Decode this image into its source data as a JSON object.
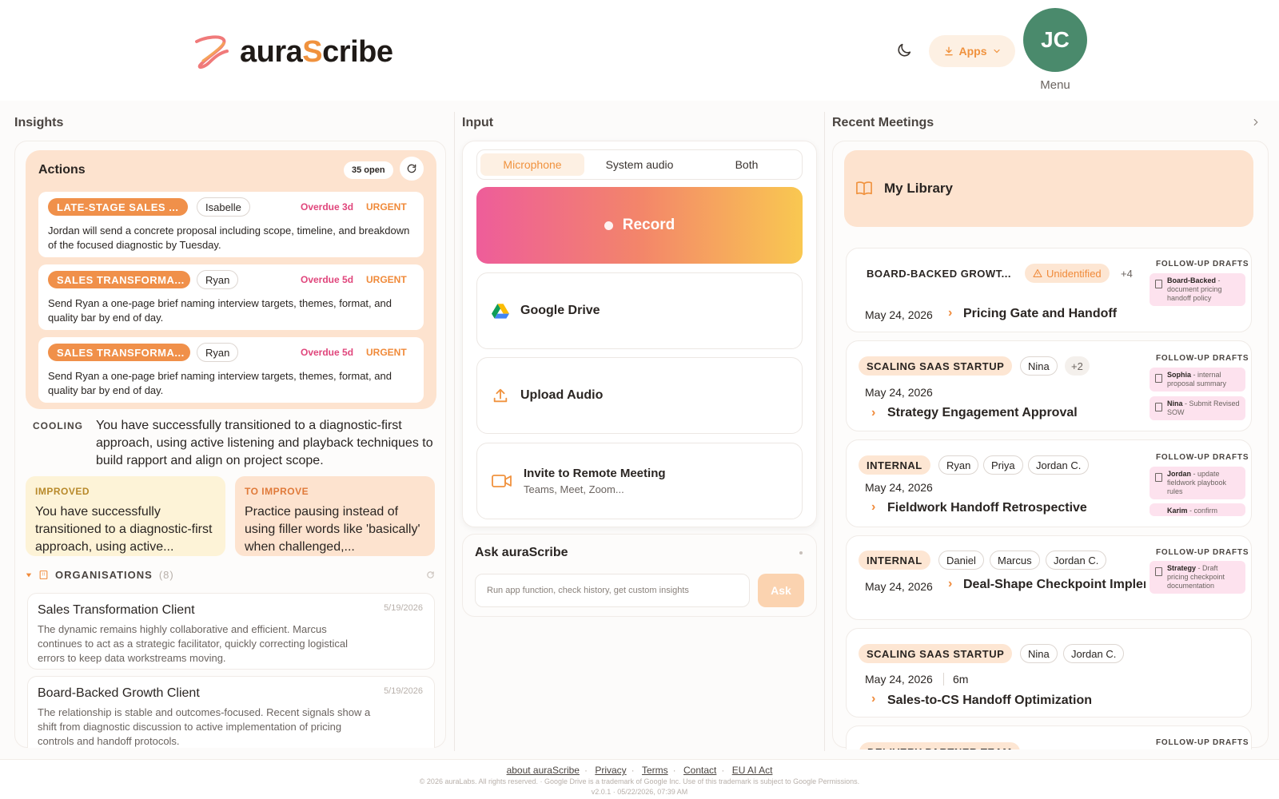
{
  "header": {
    "logo_prefix": "aura",
    "logo_highlight": "S",
    "logo_suffix": "cribe",
    "apps_label": "Apps",
    "avatar_initials": "JC",
    "menu_label": "Menu"
  },
  "columns": {
    "insights": "Insights",
    "input": "Input",
    "recent": "Recent Meetings"
  },
  "actions": {
    "title": "Actions",
    "open_count": "35 open",
    "items": [
      {
        "tag": "LATE-STAGE SALES ...",
        "person": "Isabelle",
        "overdue": "Overdue 3d",
        "urgency": "URGENT",
        "text": "Jordan will send a concrete proposal including scope, timeline, and breakdown of the focused diagnostic by Tuesday."
      },
      {
        "tag": "SALES TRANSFORMA...",
        "person": "Ryan",
        "overdue": "Overdue 5d",
        "urgency": "URGENT",
        "text": "Send Ryan a one-page brief naming interview targets, themes, format, and quality bar by end of day."
      },
      {
        "tag": "SALES TRANSFORMA...",
        "person": "Ryan",
        "overdue": "Overdue 5d",
        "urgency": "URGENT",
        "text": "Send Ryan a one-page brief naming interview targets, themes, format, and quality bar by end of day."
      }
    ]
  },
  "cooling": {
    "label": "COOLING",
    "text": "You have successfully transitioned to a diagnostic-first approach, using active listening and playback techniques to build rapport and align on project scope."
  },
  "improved": {
    "label": "IMPROVED",
    "text": "You have successfully transitioned to a diagnostic-first approach, using active..."
  },
  "to_improve": {
    "label": "TO IMPROVE",
    "text": "Practice pausing instead of using filler words like 'basically' when challenged,..."
  },
  "organisations": {
    "label": "ORGANISATIONS",
    "count": "(8)",
    "items": [
      {
        "name": "Sales Transformation Client",
        "date": "5/19/2026",
        "text": "The dynamic remains highly collaborative and efficient. Marcus continues to act as a strategic facilitator, quickly correcting logistical errors to keep data workstreams moving."
      },
      {
        "name": "Board-Backed Growth Client",
        "date": "5/19/2026",
        "text": "The relationship is stable and outcomes-focused. Recent signals show a shift from diagnostic discussion to active implementation of pricing controls and handoff protocols."
      }
    ]
  },
  "input": {
    "tabs": [
      "Microphone",
      "System audio",
      "Both"
    ],
    "active_tab": "Microphone",
    "record_label": "Record",
    "google_drive": "Google Drive",
    "upload_audio": "Upload Audio",
    "invite_title": "Invite to Remote Meeting",
    "invite_sub": "Teams, Meet, Zoom..."
  },
  "ask": {
    "title": "Ask auraScribe",
    "placeholder": "Run app function, check history, get custom insights",
    "button": "Ask"
  },
  "library": {
    "label": "My Library"
  },
  "followup_label": "FOLLOW-UP DRAFTS",
  "meetings": [
    {
      "org": "BOARD-BACKED GROWT...",
      "badge": "Unidentified",
      "more": "+4",
      "date": "May 24, 2026",
      "title": "Pricing Gate and Handoff",
      "drafts": [
        {
          "who": "Board-Backed",
          "what": " - document pricing handoff policy"
        }
      ]
    },
    {
      "org": "SCALING SAAS STARTUP",
      "people": [
        "Nina"
      ],
      "more": "+2",
      "date": "May 24, 2026",
      "title": "Strategy Engagement Approval",
      "drafts": [
        {
          "who": "Sophia",
          "what": " - internal proposal summary"
        },
        {
          "who": "Nina",
          "what": " - Submit Revised SOW"
        }
      ]
    },
    {
      "org": "INTERNAL",
      "people": [
        "Ryan",
        "Priya",
        "Jordan C."
      ],
      "date": "May 24, 2026",
      "title": "Fieldwork Handoff Retrospective",
      "drafts": [
        {
          "who": "Jordan",
          "what": " - update fieldwork playbook rules"
        },
        {
          "who": "Karim",
          "what": " - confirm"
        }
      ]
    },
    {
      "org": "INTERNAL",
      "people": [
        "Daniel",
        "Marcus",
        "Jordan C."
      ],
      "date": "May 24, 2026",
      "title": "Deal-Shape Checkpoint Implem",
      "drafts": [
        {
          "who": "Strategy",
          "what": " - Draft pricing checkpoint documentation"
        }
      ]
    },
    {
      "org": "SCALING SAAS STARTUP",
      "people": [
        "Nina",
        "Jordan C."
      ],
      "date": "May 24, 2026",
      "duration": "6m",
      "title": "Sales-to-CS Handoff Optimization"
    },
    {
      "org": "DELIVERY PARTNER TEAM"
    }
  ],
  "footer": {
    "links": [
      "about auraScribe",
      "Privacy",
      "Terms",
      "Contact",
      "EU AI Act"
    ],
    "copyright": "© 2026 auraLabs. All rights reserved. · Google Drive is a trademark of Google Inc. Use of this trademark is subject to Google Permissions.",
    "version": "v2.0.1 · 05/22/2026, 07:39 AM"
  },
  "colors": {
    "accent": "#f0923e",
    "avatar": "#4a8a6c",
    "overdue": "#e0467c"
  }
}
